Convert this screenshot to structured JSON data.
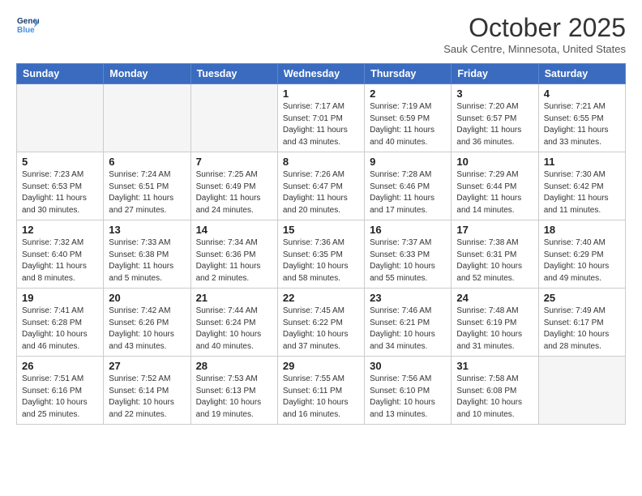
{
  "header": {
    "logo_line1": "General",
    "logo_line2": "Blue",
    "month_title": "October 2025",
    "location": "Sauk Centre, Minnesota, United States"
  },
  "weekdays": [
    "Sunday",
    "Monday",
    "Tuesday",
    "Wednesday",
    "Thursday",
    "Friday",
    "Saturday"
  ],
  "weeks": [
    [
      {
        "day": "",
        "info": ""
      },
      {
        "day": "",
        "info": ""
      },
      {
        "day": "",
        "info": ""
      },
      {
        "day": "1",
        "info": "Sunrise: 7:17 AM\nSunset: 7:01 PM\nDaylight: 11 hours\nand 43 minutes."
      },
      {
        "day": "2",
        "info": "Sunrise: 7:19 AM\nSunset: 6:59 PM\nDaylight: 11 hours\nand 40 minutes."
      },
      {
        "day": "3",
        "info": "Sunrise: 7:20 AM\nSunset: 6:57 PM\nDaylight: 11 hours\nand 36 minutes."
      },
      {
        "day": "4",
        "info": "Sunrise: 7:21 AM\nSunset: 6:55 PM\nDaylight: 11 hours\nand 33 minutes."
      }
    ],
    [
      {
        "day": "5",
        "info": "Sunrise: 7:23 AM\nSunset: 6:53 PM\nDaylight: 11 hours\nand 30 minutes."
      },
      {
        "day": "6",
        "info": "Sunrise: 7:24 AM\nSunset: 6:51 PM\nDaylight: 11 hours\nand 27 minutes."
      },
      {
        "day": "7",
        "info": "Sunrise: 7:25 AM\nSunset: 6:49 PM\nDaylight: 11 hours\nand 24 minutes."
      },
      {
        "day": "8",
        "info": "Sunrise: 7:26 AM\nSunset: 6:47 PM\nDaylight: 11 hours\nand 20 minutes."
      },
      {
        "day": "9",
        "info": "Sunrise: 7:28 AM\nSunset: 6:46 PM\nDaylight: 11 hours\nand 17 minutes."
      },
      {
        "day": "10",
        "info": "Sunrise: 7:29 AM\nSunset: 6:44 PM\nDaylight: 11 hours\nand 14 minutes."
      },
      {
        "day": "11",
        "info": "Sunrise: 7:30 AM\nSunset: 6:42 PM\nDaylight: 11 hours\nand 11 minutes."
      }
    ],
    [
      {
        "day": "12",
        "info": "Sunrise: 7:32 AM\nSunset: 6:40 PM\nDaylight: 11 hours\nand 8 minutes."
      },
      {
        "day": "13",
        "info": "Sunrise: 7:33 AM\nSunset: 6:38 PM\nDaylight: 11 hours\nand 5 minutes."
      },
      {
        "day": "14",
        "info": "Sunrise: 7:34 AM\nSunset: 6:36 PM\nDaylight: 11 hours\nand 2 minutes."
      },
      {
        "day": "15",
        "info": "Sunrise: 7:36 AM\nSunset: 6:35 PM\nDaylight: 10 hours\nand 58 minutes."
      },
      {
        "day": "16",
        "info": "Sunrise: 7:37 AM\nSunset: 6:33 PM\nDaylight: 10 hours\nand 55 minutes."
      },
      {
        "day": "17",
        "info": "Sunrise: 7:38 AM\nSunset: 6:31 PM\nDaylight: 10 hours\nand 52 minutes."
      },
      {
        "day": "18",
        "info": "Sunrise: 7:40 AM\nSunset: 6:29 PM\nDaylight: 10 hours\nand 49 minutes."
      }
    ],
    [
      {
        "day": "19",
        "info": "Sunrise: 7:41 AM\nSunset: 6:28 PM\nDaylight: 10 hours\nand 46 minutes."
      },
      {
        "day": "20",
        "info": "Sunrise: 7:42 AM\nSunset: 6:26 PM\nDaylight: 10 hours\nand 43 minutes."
      },
      {
        "day": "21",
        "info": "Sunrise: 7:44 AM\nSunset: 6:24 PM\nDaylight: 10 hours\nand 40 minutes."
      },
      {
        "day": "22",
        "info": "Sunrise: 7:45 AM\nSunset: 6:22 PM\nDaylight: 10 hours\nand 37 minutes."
      },
      {
        "day": "23",
        "info": "Sunrise: 7:46 AM\nSunset: 6:21 PM\nDaylight: 10 hours\nand 34 minutes."
      },
      {
        "day": "24",
        "info": "Sunrise: 7:48 AM\nSunset: 6:19 PM\nDaylight: 10 hours\nand 31 minutes."
      },
      {
        "day": "25",
        "info": "Sunrise: 7:49 AM\nSunset: 6:17 PM\nDaylight: 10 hours\nand 28 minutes."
      }
    ],
    [
      {
        "day": "26",
        "info": "Sunrise: 7:51 AM\nSunset: 6:16 PM\nDaylight: 10 hours\nand 25 minutes."
      },
      {
        "day": "27",
        "info": "Sunrise: 7:52 AM\nSunset: 6:14 PM\nDaylight: 10 hours\nand 22 minutes."
      },
      {
        "day": "28",
        "info": "Sunrise: 7:53 AM\nSunset: 6:13 PM\nDaylight: 10 hours\nand 19 minutes."
      },
      {
        "day": "29",
        "info": "Sunrise: 7:55 AM\nSunset: 6:11 PM\nDaylight: 10 hours\nand 16 minutes."
      },
      {
        "day": "30",
        "info": "Sunrise: 7:56 AM\nSunset: 6:10 PM\nDaylight: 10 hours\nand 13 minutes."
      },
      {
        "day": "31",
        "info": "Sunrise: 7:58 AM\nSunset: 6:08 PM\nDaylight: 10 hours\nand 10 minutes."
      },
      {
        "day": "",
        "info": ""
      }
    ]
  ]
}
